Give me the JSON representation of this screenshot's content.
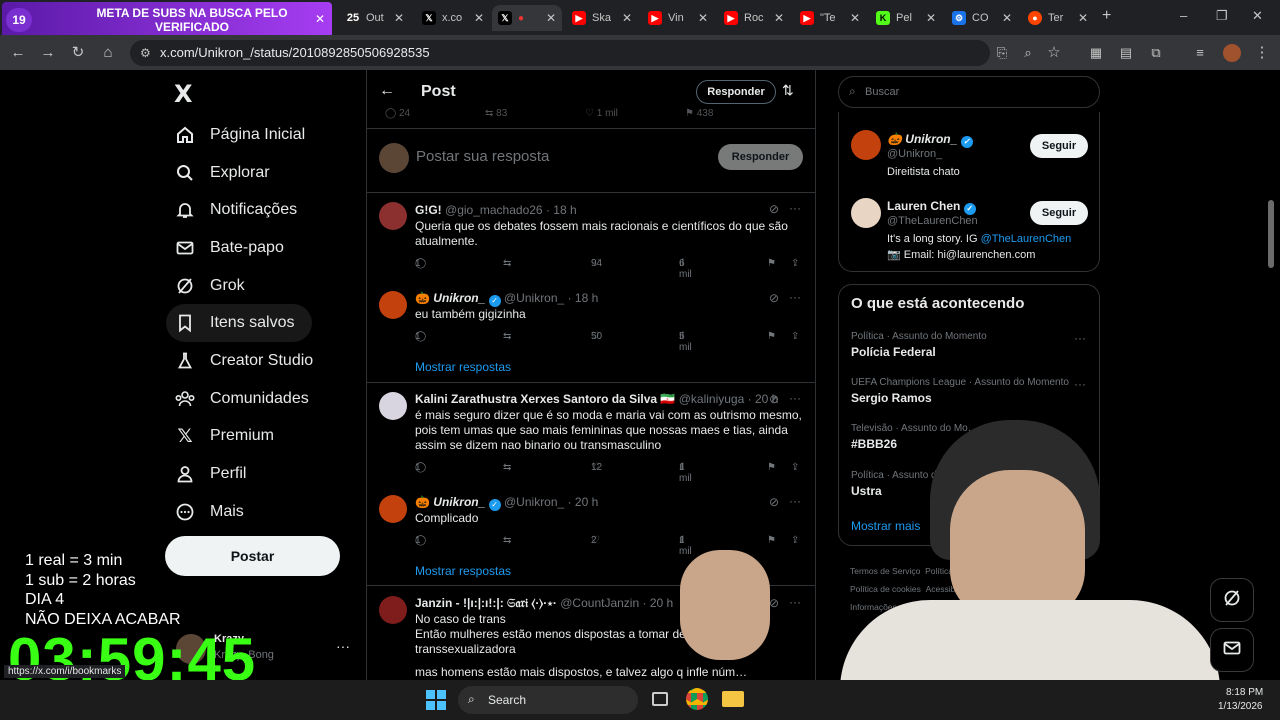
{
  "browser": {
    "tabs": [
      {
        "label": "META DE SUBS NA BUSCA PELO VERIFICADO",
        "badge": "19"
      },
      {
        "label": "Out",
        "badge": "25"
      },
      {
        "label": "x.co"
      },
      {
        "label": ""
      },
      {
        "label": "Ska"
      },
      {
        "label": "Vin"
      },
      {
        "label": "Roc"
      },
      {
        "label": "\"Te"
      },
      {
        "label": "Pel"
      },
      {
        "label": "CO"
      },
      {
        "label": "Ter"
      }
    ],
    "url": "x.com/Unikron_/status/2010892850506928535",
    "add_tab": "+",
    "minimize": "–",
    "restore": "❐",
    "close": "✕"
  },
  "sidebar": {
    "logo": "X",
    "items": [
      {
        "label": "Página Inicial",
        "icon": "home-icon"
      },
      {
        "label": "Explorar",
        "icon": "search-icon"
      },
      {
        "label": "Notificações",
        "icon": "bell-icon"
      },
      {
        "label": "Bate-papo",
        "icon": "mail-icon"
      },
      {
        "label": "Grok",
        "icon": "grok-icon"
      },
      {
        "label": "Itens salvos",
        "icon": "bookmark-icon"
      },
      {
        "label": "Creator Studio",
        "icon": "flask-icon"
      },
      {
        "label": "Comunidades",
        "icon": "communities-icon"
      },
      {
        "label": "Premium",
        "icon": "x-icon"
      },
      {
        "label": "Perfil",
        "icon": "person-icon"
      },
      {
        "label": "Mais",
        "icon": "more-circle-icon"
      }
    ],
    "post_button": "Postar",
    "account_name": "Krazy",
    "account_handle": "Krazy_Bong"
  },
  "overlay": {
    "lines": [
      "1 real = 3 min",
      "1 sub = 2 horas",
      "DIA 4",
      "NÃO DEIXA ACABAR"
    ],
    "timer": "03:59:45",
    "status_url": "https://x.com/i/bookmarks"
  },
  "post_header": {
    "title": "Post",
    "reply_button": "Responder",
    "stats": [
      "24",
      "83",
      "1 mil",
      "438"
    ]
  },
  "composer": {
    "placeholder": "Postar sua resposta",
    "button": "Responder"
  },
  "replies": [
    {
      "name": "G!G!",
      "handle": "@gio_machado26",
      "time": "· 18 h",
      "text": "Queria que os debates fossem mais racionais e científicos do que são atualmente.",
      "replies": "1",
      "likes": "94",
      "views": "6 mil"
    },
    {
      "name": "Unikron_",
      "handle": "@Unikron_",
      "time": "· 18 h",
      "text": "eu também gigizinha",
      "replies": "1",
      "likes": "50",
      "views": "5 mil",
      "show": "Mostrar respostas"
    },
    {
      "name": "Kalini Zarathustra Xerxes Santoro da Silva 🇮🇷",
      "handle": "@kaliniyuga",
      "time": "· 20 h",
      "text": "é mais seguro dizer que é so moda e maria vai com as outrismo mesmo, pois tem umas que sao mais femininas que nossas maes e tias, ainda assim se dizem nao binario ou transmasculino",
      "replies": "1",
      "likes": "12",
      "views": "1 mil"
    },
    {
      "name": "Unikron_",
      "handle": "@Unikron_",
      "time": "· 20 h",
      "text": "Complicado",
      "replies": "1",
      "likes": "2",
      "views": "1 mil",
      "show": "Mostrar respostas"
    },
    {
      "name": "Janzin - !|ı:|:ı!:|: 𝔖𝔞𝔯𝔦 ⟨·⟩·⋆·",
      "handle": "@CountJanzin",
      "time": "· 20 h",
      "line1": "No caso de trans",
      "line2": "Então mulheres estão menos dispostas a tomar dec… er cirurgia transsexualizadora",
      "line3": "mas homens estão mais dispostos, e talvez algo q infle núm…"
    }
  ],
  "right": {
    "search_placeholder": "Buscar",
    "follow": [
      {
        "name": "Unikron_",
        "handle": "@Unikron_",
        "bio": "Direitista chato",
        "button": "Seguir"
      },
      {
        "name": "Lauren Chen",
        "handle": "@TheLaurenChen",
        "bio_prefix": "It's a long story. IG ",
        "bio_link": "@TheLaurenChen",
        "bio2": "📷 Email: hi@laurenchen.com",
        "button": "Seguir"
      }
    ],
    "trends_title": "O que está acontecendo",
    "trends": [
      {
        "category": "Política · Assunto do Momento",
        "name": "Polícia Federal"
      },
      {
        "category": "UEFA Champions League · Assunto do Momento",
        "name": "Sergio Ramos"
      },
      {
        "category": "Televisão · Assunto do Mo…",
        "name": "#BBB26"
      },
      {
        "category": "Política · Assunto do Mo…",
        "name": "Ustra"
      }
    ],
    "show_more": "Mostrar mais",
    "footer": [
      "Termos de Serviço",
      "Política d…",
      "Política de cookies",
      "Acessib…",
      "Informações…"
    ]
  },
  "taskbar": {
    "search": "Search",
    "time": "8:18 PM",
    "date": "1/13/2026"
  },
  "colors": {
    "accent": "#1d9bf0",
    "timer_green": "#39ff14",
    "banner_purple": "#8a2be2"
  }
}
